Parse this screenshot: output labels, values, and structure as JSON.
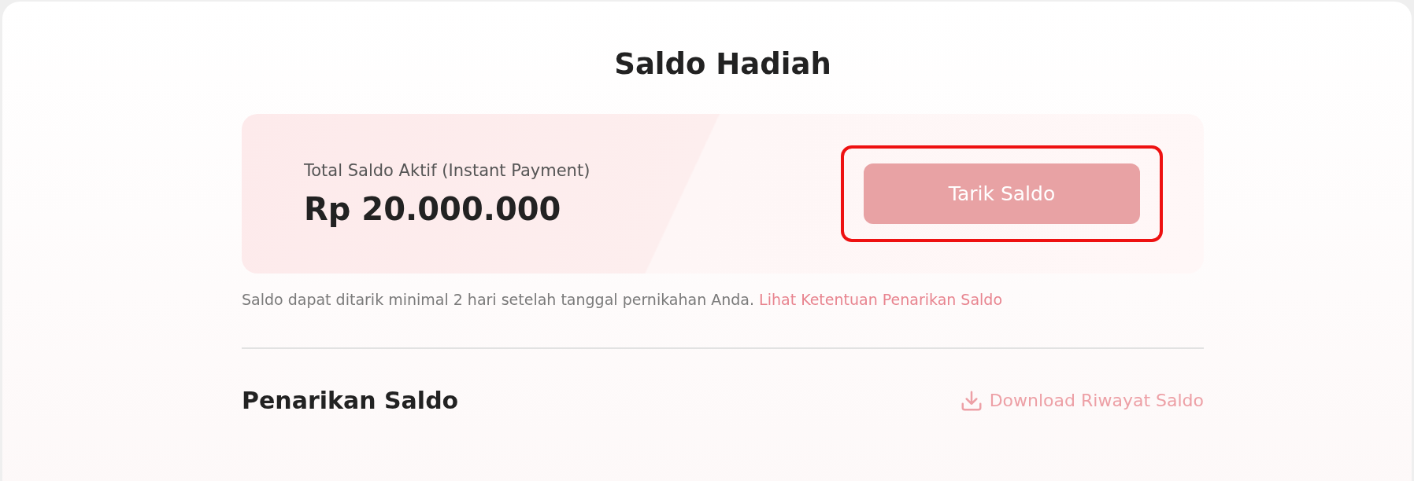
{
  "title": "Saldo Hadiah",
  "balance_card": {
    "label": "Total Saldo Aktif (Instant Payment)",
    "amount": "Rp 20.000.000",
    "button": {
      "label": "Tarik Saldo",
      "disabled": true,
      "highlighted": true
    }
  },
  "note": {
    "text": "Saldo dapat ditarik minimal 2 hari setelah tanggal pernikahan Anda.",
    "link": "Lihat Ketentuan Penarikan Saldo"
  },
  "section": {
    "heading": "Penarikan Saldo",
    "action": "Download Riwayat Saldo"
  }
}
